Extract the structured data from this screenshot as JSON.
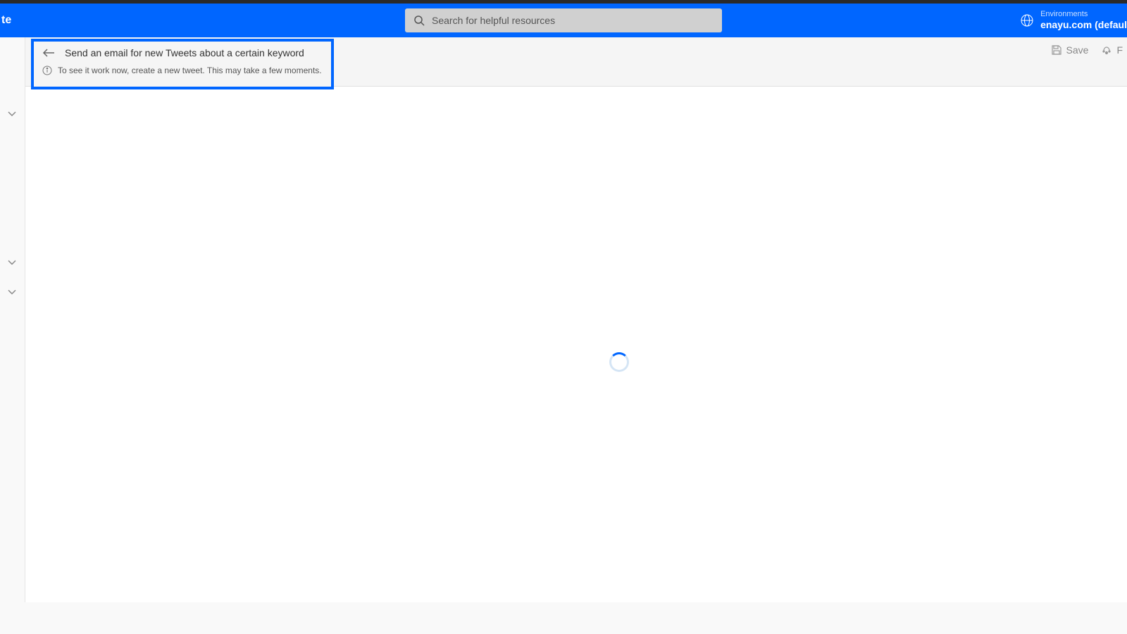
{
  "header": {
    "left_fragment": "te",
    "search_placeholder": "Search for helpful resources",
    "env_label": "Environments",
    "env_value": "enayu.com (defaul"
  },
  "flow": {
    "title": "Send an email for new Tweets about a certain keyword",
    "info_text": "To see it work now, create a new tweet. This may take a few moments."
  },
  "toolbar": {
    "save_label": "Save",
    "flow_checker_fragment": "F"
  }
}
